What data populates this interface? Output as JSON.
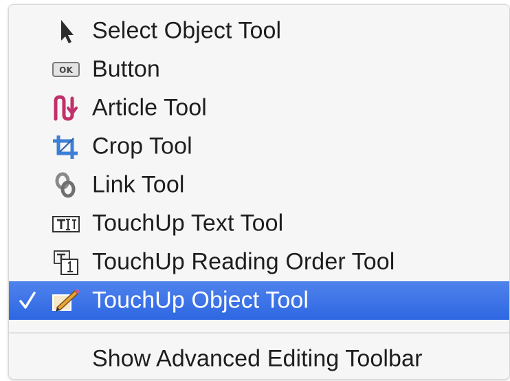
{
  "menu": {
    "items": [
      {
        "label": "Select Object Tool",
        "icon": "arrow-pointer-icon",
        "checked": false,
        "selected": false
      },
      {
        "label": "Button",
        "icon": "ok-button-icon",
        "icon_text": "OK",
        "checked": false,
        "selected": false
      },
      {
        "label": "Article Tool",
        "icon": "article-icon",
        "checked": false,
        "selected": false
      },
      {
        "label": "Crop Tool",
        "icon": "crop-icon",
        "checked": false,
        "selected": false
      },
      {
        "label": "Link Tool",
        "icon": "link-icon",
        "checked": false,
        "selected": false
      },
      {
        "label": "TouchUp Text Tool",
        "icon": "touchup-text-icon",
        "checked": false,
        "selected": false
      },
      {
        "label": "TouchUp Reading Order Tool",
        "icon": "reading-order-icon",
        "checked": false,
        "selected": false
      },
      {
        "label": "TouchUp Object Tool",
        "icon": "touchup-object-icon",
        "checked": true,
        "selected": true
      }
    ],
    "footer_item": {
      "label": "Show Advanced Editing Toolbar"
    }
  },
  "colors": {
    "selection": "#3b73e8",
    "article_icon": "#c0306a",
    "crop_icon": "#3d7fd6"
  }
}
